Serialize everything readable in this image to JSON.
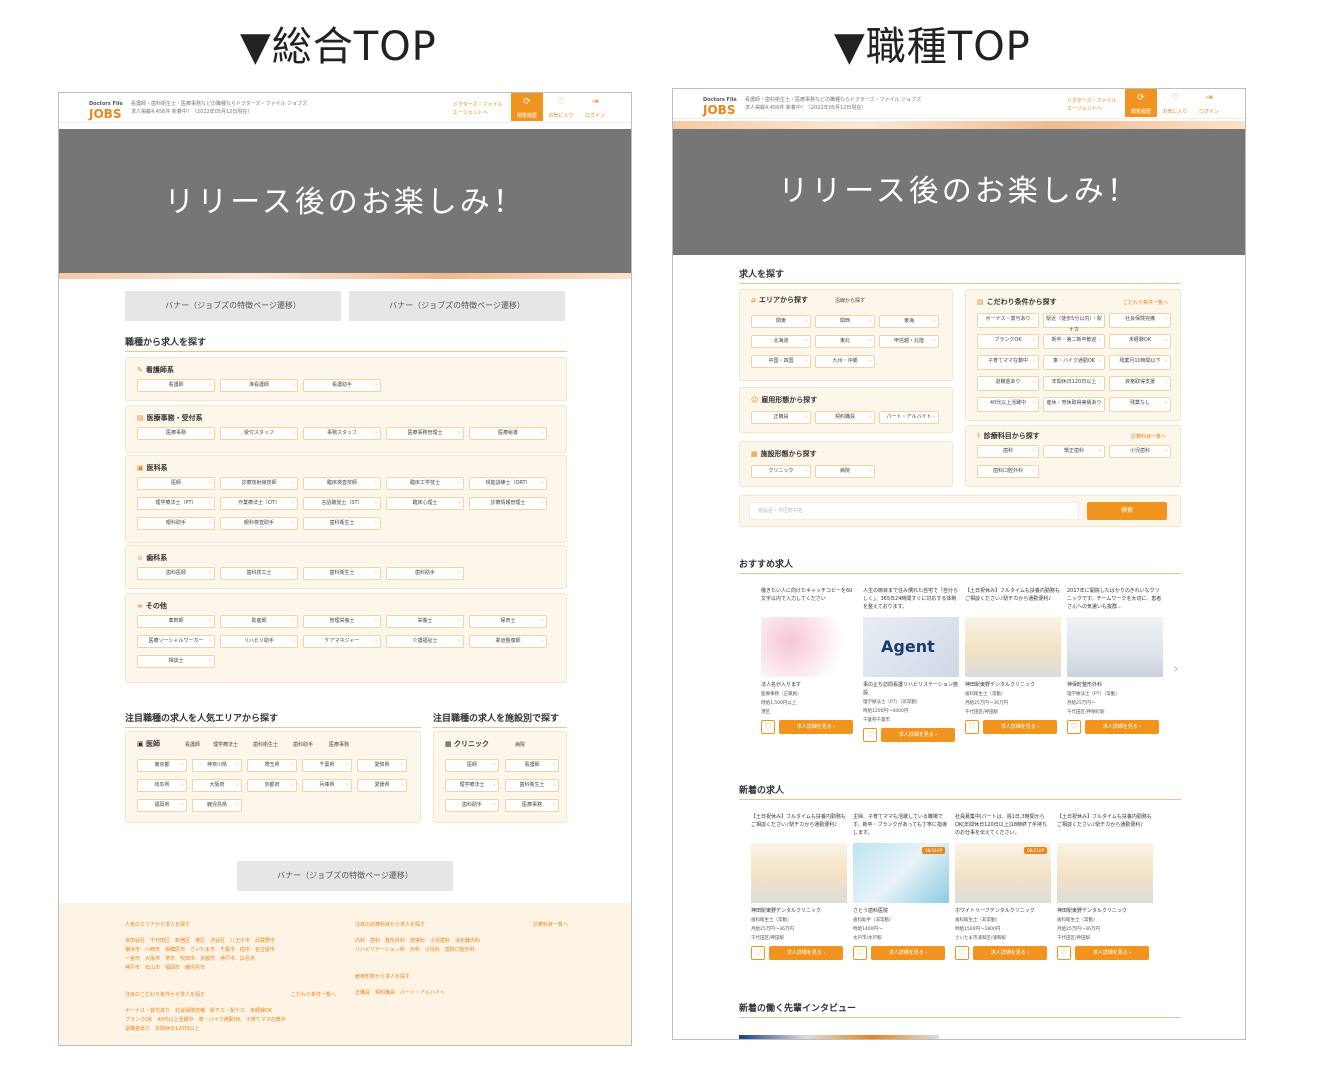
{
  "titles": {
    "left": "▼総合TOP",
    "right": "▼職種TOP"
  },
  "header": {
    "logo": "JOBS",
    "logo_sub": "Doctors File",
    "desc_line1": "看護師・歯科衛生士・医療事務などの職種ならドクターズ・ファイル ジョブズ",
    "desc_line2": "求人掲載4,456件 新着中！（2022年05月12日現在）",
    "agent_line1": "ドクターズ・ファイル",
    "agent_line2": "エージェントへ",
    "btn_history": "閲覧履歴",
    "btn_favorite": "お気に入り",
    "btn_login": "ログイン"
  },
  "hero_text": "リリース後のお楽しみ！",
  "left": {
    "banner_label": "バナー（ジョブズの特徴ページ遷移）",
    "occupation_title": "職種から求人を探す",
    "groups": [
      {
        "label": "看護師系",
        "icon": "pen-icon",
        "items": [
          "看護師",
          "准看護師",
          "看護助手"
        ]
      },
      {
        "label": "医療事務・受付系",
        "icon": "document-icon",
        "items": [
          "医療事務",
          "受付スタッフ",
          "事務スタッフ",
          "医療事務管理士",
          "医療秘書"
        ]
      },
      {
        "label": "医科系",
        "icon": "clinic-icon",
        "items": [
          "医師",
          "診療放射線技師",
          "臨床検査技師",
          "臨床工学技士",
          "視能訓練士（ORT）",
          "理学療法士（PT）",
          "作業療法士（OT）",
          "言語聴覚士（ST）",
          "臨床心理士",
          "診療情報管理士",
          "眼科助手",
          "眼科検査助手",
          "歯科衛生士"
        ]
      },
      {
        "label": "歯科系",
        "icon": "tooth-icon",
        "items": [
          "歯科医師",
          "歯科技工士",
          "歯科衛生士",
          "歯科助手"
        ]
      },
      {
        "label": "その他",
        "icon": "dots-icon",
        "items": [
          "薬剤師",
          "助産師",
          "管理栄養士",
          "栄養士",
          "保育士",
          "医療ソーシャルワーカー",
          "リハビリ助手",
          "ケアマネジャー",
          "介護福祉士",
          "柔道整復師",
          "相談士"
        ]
      }
    ],
    "area_title": "注目職種の求人を人気エリアから探す",
    "area_tabs": [
      "医師",
      "看護師",
      "理学療法士",
      "歯科衛生士",
      "歯科助手",
      "医療事務"
    ],
    "area_items": [
      "東京都",
      "神奈川県",
      "埼玉県",
      "千葉県",
      "愛知県",
      "岐阜県",
      "大阪府",
      "京都府",
      "兵庫県",
      "愛媛県",
      "福岡県",
      "鹿児島県"
    ],
    "facility_title": "注目職種の求人を施設別で探す",
    "facility_tabs": [
      "クリニック",
      "病院"
    ],
    "facility_items": [
      "医師",
      "看護師",
      "理学療法士",
      "歯科衛生士",
      "歯科助手",
      "医療事務"
    ],
    "footer": {
      "area_head": "人気のエリアから求人を探す",
      "area_text": [
        "世田谷区　千代田区　新宿区　港区　渋谷区　八王子市　武蔵野市",
        "横浜市　川崎市　相模原市　さいたま市　千葉市　柏市　名古屋市",
        "一宮市　大阪市　堺市　吹田市　京都市　神戸市　広島市",
        "神戸市　松山市　福岡市　鹿児島市"
      ],
      "clinic_head": "注目の診療科目から求人を探す",
      "clinic_text": [
        "内科　歯科　整形外科　皮膚科　小児歯科　消化器内科",
        "リハビリテーション科　外科　小児科　歯科口腔外科"
      ],
      "clinic_link": "診療科目一覧へ",
      "condition_head": "注目のこだわり条件から求人を探す",
      "condition_text": [
        "ボーナス・賞与あり　社会保険完備　駅チカ・駅ナカ　未経験OK",
        "ブランクOK　40代以上活躍中　車・バイク通勤OK　子育てママ在籍中",
        "退職金あり　年間休日120日以上"
      ],
      "condition_link": "こだわり条件一覧へ",
      "employment_head": "雇用形態から求人を探す",
      "employment_text": [
        "正職員　契約職員　パート・アルバイト"
      ]
    }
  },
  "right": {
    "search_title": "求人を探す",
    "area_label": "エリアから探す",
    "area_tab2": "沿線から探す",
    "area_items": [
      "関東",
      "関西",
      "東海",
      "北海道",
      "東北",
      "甲信越・北陸",
      "中国・四国",
      "九州・沖縄"
    ],
    "employment_label": "雇用形態から探す",
    "employment_items": [
      "正職員",
      "契約職員",
      "パート・アルバイト"
    ],
    "facility_label": "施設形態から探す",
    "facility_items": [
      "クリニック",
      "病院"
    ],
    "condition_label": "こだわり条件から探す",
    "condition_link": "こだわり条件一覧へ",
    "condition_items": [
      "ボーナス・賞与あり",
      "駅近（徒歩5分以内）・駅ナカ",
      "社会保険完備",
      "ブランクOK",
      "新卒・第二新卒歓迎",
      "未経験OK",
      "子育てママ在籍中",
      "車・バイク通勤OK",
      "残業月10時間以下",
      "退職金あり",
      "年間休日120日以上",
      "資格取得支援",
      "40代以上活躍中",
      "産休・育休取得実績あり",
      "残業なし"
    ],
    "dept_label": "診療科目から探す",
    "dept_link": "診療科目一覧へ",
    "dept_items": [
      "歯科",
      "矯正歯科",
      "小児歯科",
      "歯科口腔外科"
    ],
    "search_placeholder": "施設名・市区町村名",
    "search_button": "検索",
    "recommended_title": "おすすめ求人",
    "recommended": [
      {
        "text": "働きたい人に向けたキャッチコピーを60文字以内で入力してください",
        "name": "法人名が入ります",
        "meta": [
          "医療事務（正職員）",
          "時給1,500円以上",
          "港区"
        ],
        "img": "cherry"
      },
      {
        "text": "人生の節目まで住み慣れた自宅で「自分らしく」。365日24時間すぐに対応する体制を整えております。",
        "name": "事の止ち訪問看護リハビリステーション施設",
        "meta": [
          "理学療法士（PT）（非常勤）",
          "時給1200円～4000円",
          "千葉県千葉市"
        ],
        "img": "agent"
      },
      {
        "text": "【土日祝休み】フルタイムも扶養内勤務もご相談ください♪駅チカから通勤便利♪",
        "name": "神田駅東野デンタルクリニック",
        "meta": [
          "歯科衛生士（常勤）",
          "月給25万円～36万円",
          "千代田区/神田駅"
        ],
        "img": "dental"
      },
      {
        "text": "2017年に開院したばかりのきれいなクリニックです。チームワークを大切に、患者さんへの気遣いも抜群…",
        "name": "神保町整形外科",
        "meta": [
          "理学療法士（PT）（常勤）",
          "月給25万円～",
          "千代田区/神保町駅"
        ],
        "img": "clinic"
      }
    ],
    "new_title": "新着の求人",
    "newjobs": [
      {
        "text": "【土日祝休み】フルタイムも扶養内勤務もご相談ください♪駅チカから通勤便利♪",
        "name": "神田駅東野デンタルクリニック",
        "meta": [
          "歯科衛生士（常勤）",
          "月給25万円～36万円",
          "千代田区/神田駅"
        ],
        "img": "dental",
        "badge": ""
      },
      {
        "text": "主婦、子育てママも活躍している職場です。新卒・ブランクがあっても丁寧に指導します。",
        "name": "さとう歯科医院",
        "meta": [
          "歯科助手（非常勤）",
          "時給1400円～",
          "水戸市/水戸駅"
        ],
        "img": "chair",
        "badge": "08/24UP"
      },
      {
        "text": "社員募集中|パートは、週1日,3時間からOK[年間休日120日以上]18時終了手持ちのお仕事を伝えてください。",
        "name": "ホワイトリーフデンタルクリニック",
        "meta": [
          "歯科衛生士（非常勤）",
          "時給1500円～1800円",
          "さいたま市浦和区/浦和駅"
        ],
        "img": "dental",
        "badge": "08/21UP"
      },
      {
        "text": "【土日祝休み】フルタイムも扶養内勤務もご相談ください♪駅チカから通勤便利♪",
        "name": "神田駅東野デンタルクリニック",
        "meta": [
          "歯科衛生士（常勤）",
          "月給25万円～36万円",
          "千代田区/神田駅"
        ],
        "img": "dental",
        "badge": ""
      }
    ],
    "detail_button": "求人詳細を見る",
    "interview_title": "新着の働く先輩インタビュー"
  },
  "colors": {
    "accent": "#f0941f",
    "hero": "#767676",
    "box": "#fdf6ea"
  }
}
